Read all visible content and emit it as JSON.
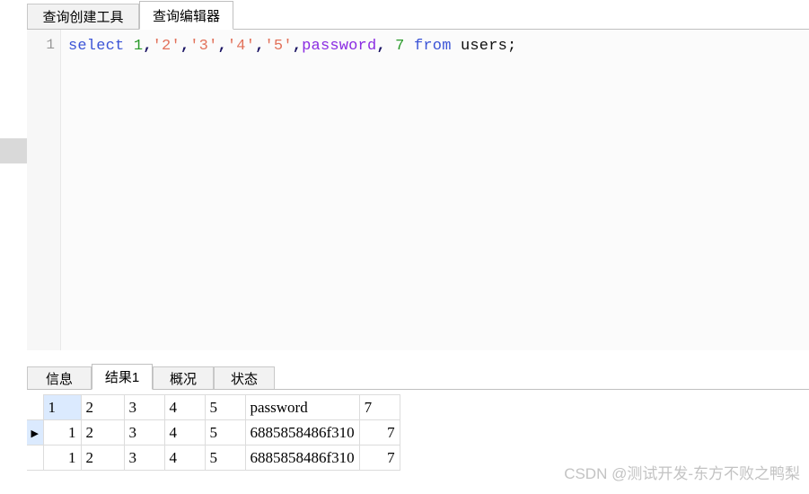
{
  "top_tabs": {
    "items": [
      {
        "label": "查询创建工具",
        "active": false
      },
      {
        "label": "查询编辑器",
        "active": true
      }
    ]
  },
  "editor": {
    "line_number": "1",
    "sql_tokens": [
      {
        "text": "select",
        "type": "keyword"
      },
      {
        "text": " ",
        "type": "plain"
      },
      {
        "text": "1",
        "type": "number"
      },
      {
        "text": ",",
        "type": "punct"
      },
      {
        "text": "'2'",
        "type": "string"
      },
      {
        "text": ",",
        "type": "punct"
      },
      {
        "text": "'3'",
        "type": "string"
      },
      {
        "text": ",",
        "type": "punct"
      },
      {
        "text": "'4'",
        "type": "string"
      },
      {
        "text": ",",
        "type": "punct"
      },
      {
        "text": "'5'",
        "type": "string"
      },
      {
        "text": ",",
        "type": "punct"
      },
      {
        "text": "password",
        "type": "identifier"
      },
      {
        "text": ",",
        "type": "punct"
      },
      {
        "text": " ",
        "type": "plain"
      },
      {
        "text": "7",
        "type": "number"
      },
      {
        "text": " ",
        "type": "plain"
      },
      {
        "text": "from",
        "type": "keyword"
      },
      {
        "text": " ",
        "type": "plain"
      },
      {
        "text": "users;",
        "type": "plain"
      }
    ],
    "sql_text": "select 1,'2','3','4','5',password, 7 from users;"
  },
  "result_tabs": {
    "items": [
      {
        "label": "信息",
        "active": false
      },
      {
        "label": "结果1",
        "active": true
      },
      {
        "label": "概况",
        "active": false
      },
      {
        "label": "状态",
        "active": false
      }
    ]
  },
  "grid": {
    "columns": [
      "1",
      "2",
      "3",
      "4",
      "5",
      "password",
      "7"
    ],
    "selected_column_index": 0,
    "rows": [
      {
        "current": true,
        "marker": "▶",
        "cells": [
          "1",
          "2",
          "3",
          "4",
          "5",
          "6885858486f310",
          "7"
        ]
      },
      {
        "current": false,
        "marker": "",
        "cells": [
          "1",
          "2",
          "3",
          "4",
          "5",
          "6885858486f310",
          "7"
        ]
      }
    ]
  },
  "watermark": {
    "text": "CSDN @测试开发-东方不败之鸭梨"
  },
  "colors": {
    "keyword": "#3b54d6",
    "number": "#2a9a2a",
    "string": "#e2725b",
    "identifier": "#8a2be2",
    "punct": "#1b1464",
    "selection": "#dbeafe",
    "watermark": "#c3c3c3"
  }
}
